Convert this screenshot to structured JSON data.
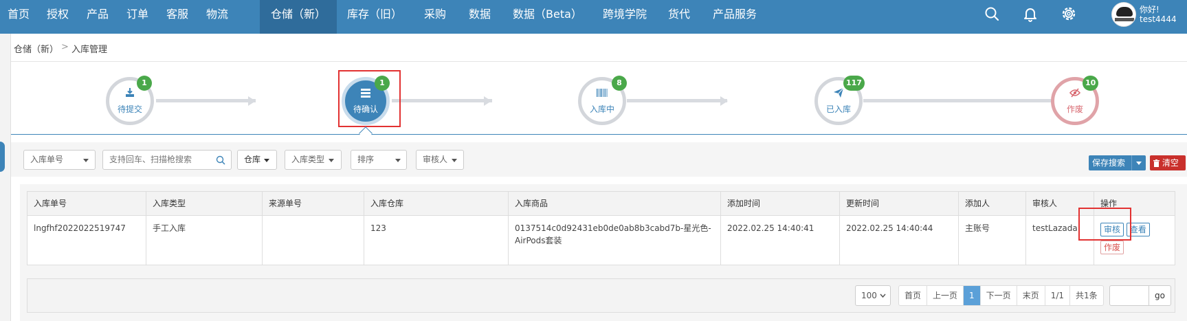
{
  "nav": {
    "items": [
      {
        "label": "首页"
      },
      {
        "label": "授权"
      },
      {
        "label": "产品"
      },
      {
        "label": "订单"
      },
      {
        "label": "客服"
      },
      {
        "label": "物流"
      },
      {
        "label": "仓储（新）",
        "active": true
      },
      {
        "label": "库存（旧）"
      },
      {
        "label": "采购"
      },
      {
        "label": "数据"
      },
      {
        "label": "数据（Beta）"
      },
      {
        "label": "跨境学院"
      },
      {
        "label": "货代"
      },
      {
        "label": "产品服务"
      }
    ],
    "icons": [
      "search-icon",
      "bell-icon",
      "gear-icon"
    ],
    "greeting": "你好!",
    "username": "test4444"
  },
  "breadcrumb": {
    "parent": "仓储（新）",
    "separator": ">",
    "current": "入库管理"
  },
  "steps": [
    {
      "label": "待提交",
      "count": "1",
      "icon": "download-icon"
    },
    {
      "label": "待确认",
      "count": "1",
      "icon": "list-icon",
      "active": true
    },
    {
      "label": "入库中",
      "count": "8",
      "icon": "barcode-icon"
    },
    {
      "label": "已入库",
      "count": "117",
      "icon": "paper-plane-icon"
    },
    {
      "label": "作废",
      "count": "10",
      "icon": "eye-slash-icon"
    }
  ],
  "filters": {
    "order_no_select": "入库单号",
    "search_placeholder": "支持回车、扫描枪搜索",
    "warehouse": "仓库",
    "type": "入库类型",
    "sort": "排序",
    "reviewer": "审核人",
    "save_search": "保存搜索",
    "clear": "清空"
  },
  "table": {
    "columns": [
      "入库单号",
      "入库类型",
      "来源单号",
      "入库仓库",
      "入库商品",
      "添加时间",
      "更新时间",
      "添加人",
      "审核人",
      "操作"
    ],
    "rows": [
      {
        "order_no": "lngfhf2022022519747",
        "type": "手工入库",
        "source_no": "",
        "warehouse": "123",
        "product": "0137514c0d92431eb0de0ab8b3cabd7b-星光色-AirPods套装",
        "added": "2022.02.25 14:40:41",
        "updated": "2022.02.25 14:40:44",
        "added_by": "主账号",
        "reviewer": "testLazada",
        "actions": {
          "review": "审核",
          "view": "查看",
          "void": "作废"
        }
      }
    ]
  },
  "pagination": {
    "page_size": "100",
    "first": "首页",
    "prev": "上一页",
    "current": "1",
    "next": "下一页",
    "last": "末页",
    "pages": "1/1",
    "total": "共1条",
    "go": "go"
  },
  "colors": {
    "nav_bg": "#3d84b8",
    "nav_active": "#2f6c9b",
    "badge": "#4aa84a",
    "highlight": "#e23131",
    "danger": "#c9302c"
  }
}
